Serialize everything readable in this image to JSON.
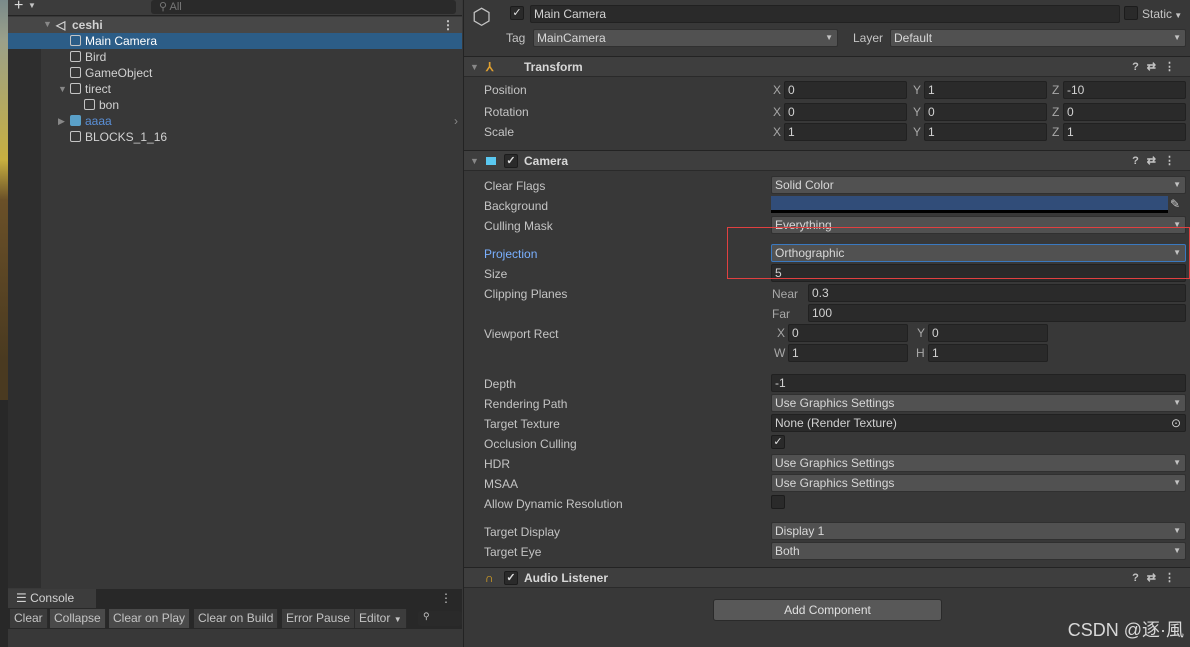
{
  "hierarchy": {
    "add_label": "+",
    "search_placeholder": "All",
    "scene": "ceshi",
    "items": [
      {
        "label": "Main Camera",
        "selected": true
      },
      {
        "label": "Bird"
      },
      {
        "label": "GameObject"
      },
      {
        "label": "tirect",
        "expanded": true
      },
      {
        "label": "bon"
      },
      {
        "label": "aaaa",
        "prefab": true,
        "collapsed": true
      },
      {
        "label": "BLOCKS_1_16"
      }
    ]
  },
  "console": {
    "tab": "Console",
    "buttons": [
      "Clear",
      "Collapse",
      "Clear on Play",
      "Clear on Build",
      "Error Pause",
      "Editor"
    ]
  },
  "inspector": {
    "name": "Main Camera",
    "active": true,
    "static_label": "Static",
    "static": false,
    "tag_label": "Tag",
    "tag": "MainCamera",
    "layer_label": "Layer",
    "layer": "Default",
    "transform": {
      "title": "Transform",
      "rows": [
        {
          "label": "Position",
          "x": "0",
          "y": "1",
          "z": "-10"
        },
        {
          "label": "Rotation",
          "x": "0",
          "y": "0",
          "z": "0"
        },
        {
          "label": "Scale",
          "x": "1",
          "y": "1",
          "z": "1"
        }
      ],
      "axes": [
        "X",
        "Y",
        "Z"
      ]
    },
    "camera": {
      "title": "Camera",
      "enabled": true,
      "clear_flags_label": "Clear Flags",
      "clear_flags": "Solid Color",
      "background_label": "Background",
      "background_color": "#314d79",
      "culling_mask_label": "Culling Mask",
      "culling_mask": "Everything",
      "projection_label": "Projection",
      "projection": "Orthographic",
      "size_label": "Size",
      "size": "5",
      "clipping_label": "Clipping Planes",
      "near_label": "Near",
      "near": "0.3",
      "far_label": "Far",
      "far": "100",
      "viewport_label": "Viewport Rect",
      "vx": "0",
      "vy": "0",
      "vw": "1",
      "vh": "1",
      "vp_axes": [
        "X",
        "Y",
        "W",
        "H"
      ],
      "depth_label": "Depth",
      "depth": "-1",
      "rendering_path_label": "Rendering Path",
      "rendering_path": "Use Graphics Settings",
      "target_texture_label": "Target Texture",
      "target_texture": "None (Render Texture)",
      "occlusion_label": "Occlusion Culling",
      "occlusion": true,
      "hdr_label": "HDR",
      "hdr": "Use Graphics Settings",
      "msaa_label": "MSAA",
      "msaa": "Use Graphics Settings",
      "dynres_label": "Allow Dynamic Resolution",
      "dynres": false,
      "target_display_label": "Target Display",
      "target_display": "Display 1",
      "target_eye_label": "Target Eye",
      "target_eye": "Both"
    },
    "audio": {
      "title": "Audio Listener",
      "enabled": true
    },
    "add_component": "Add Component"
  },
  "watermark": "CSDN @逐·風",
  "colors": {
    "selection": "#2c5d87",
    "highlight_box": "#e04040",
    "projection_label": "#7ab0ff",
    "prefab": "#5a8fd6"
  }
}
